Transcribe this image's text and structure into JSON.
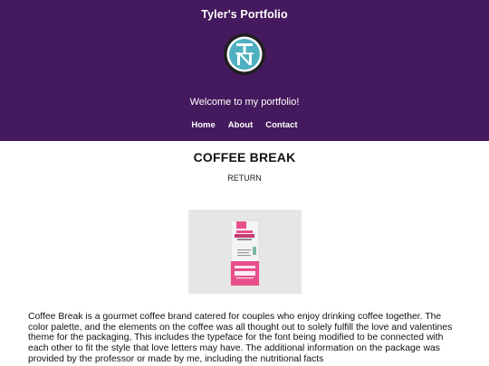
{
  "colors": {
    "header_bg": "#44195d",
    "logo_ring": "#1f1f1f",
    "logo_fill": "#4eb0c0",
    "pink_package": "#e84e8a"
  },
  "header": {
    "site_title": "Tyler's Portfolio",
    "logo_icon": "tn-monogram-logo",
    "welcome": "Welcome to my portfolio!",
    "nav": [
      {
        "label": "Home"
      },
      {
        "label": "About"
      },
      {
        "label": "Contact"
      }
    ]
  },
  "main": {
    "title": "COFFEE BREAK",
    "return_label": "RETURN",
    "image_icon": "coffee-package-image",
    "description": "Coffee Break is a gourmet coffee brand catered for couples who enjoy drinking coffee together. The color palette, and the elements on the coffee was all thought out to solely fulfill the love and valentines theme for the packaging, This includes the typeface for the font being modified to be connected with each other to fit the style that love letters may have. The additional information on the package was provided by the professor or made by me, including the nutritional facts"
  }
}
